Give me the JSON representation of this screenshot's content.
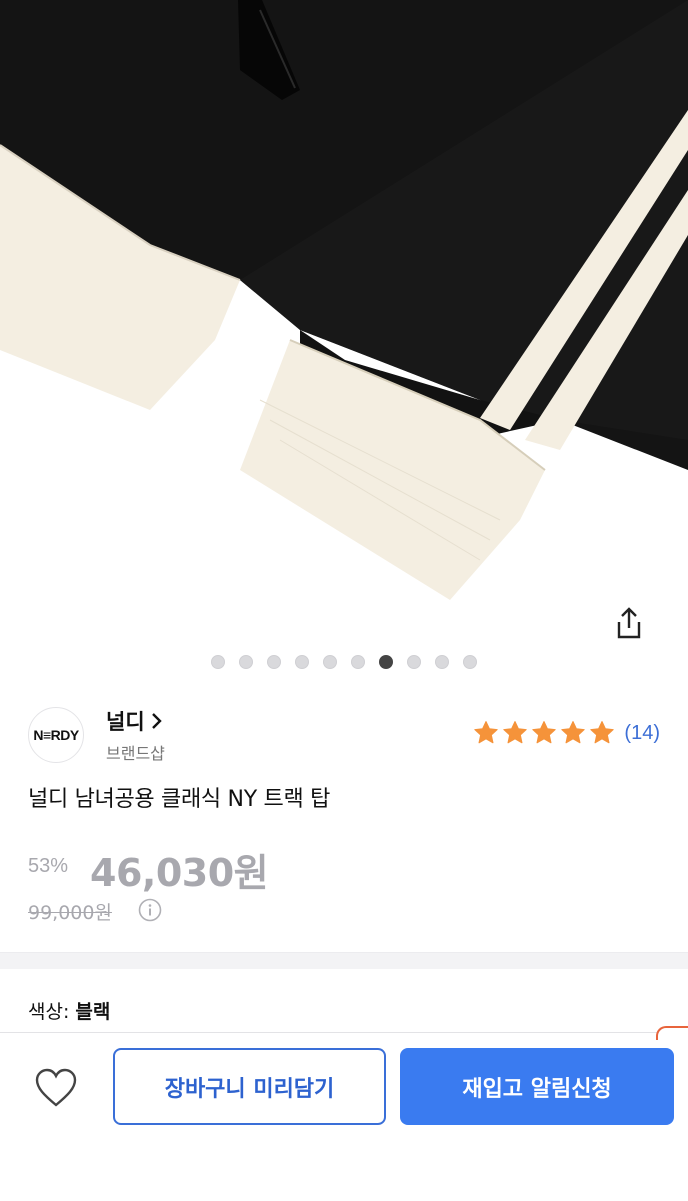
{
  "gallery": {
    "image": "black-track-jacket-sleeve-photo",
    "slide_count": 10,
    "active_index": 6
  },
  "brand": {
    "logo_text": "N≡RDY",
    "name": "널디",
    "subtitle": "브랜드샵"
  },
  "rating": {
    "stars": 5,
    "review_count": "(14)"
  },
  "product": {
    "title": "널디 남녀공용 클래식 NY 트랙 탑",
    "discount": "53%",
    "price": "46,030원",
    "original_price": "99,000원"
  },
  "options": {
    "color_label": "색상: ",
    "color_value": "블랙"
  },
  "actions": {
    "cart_label": "장바구니 미리담기",
    "restock_label": "재입고 알림신청"
  },
  "colors": {
    "accent": "#3a7bf0",
    "star": "#f5933a",
    "muted": "#a8a8ae"
  }
}
